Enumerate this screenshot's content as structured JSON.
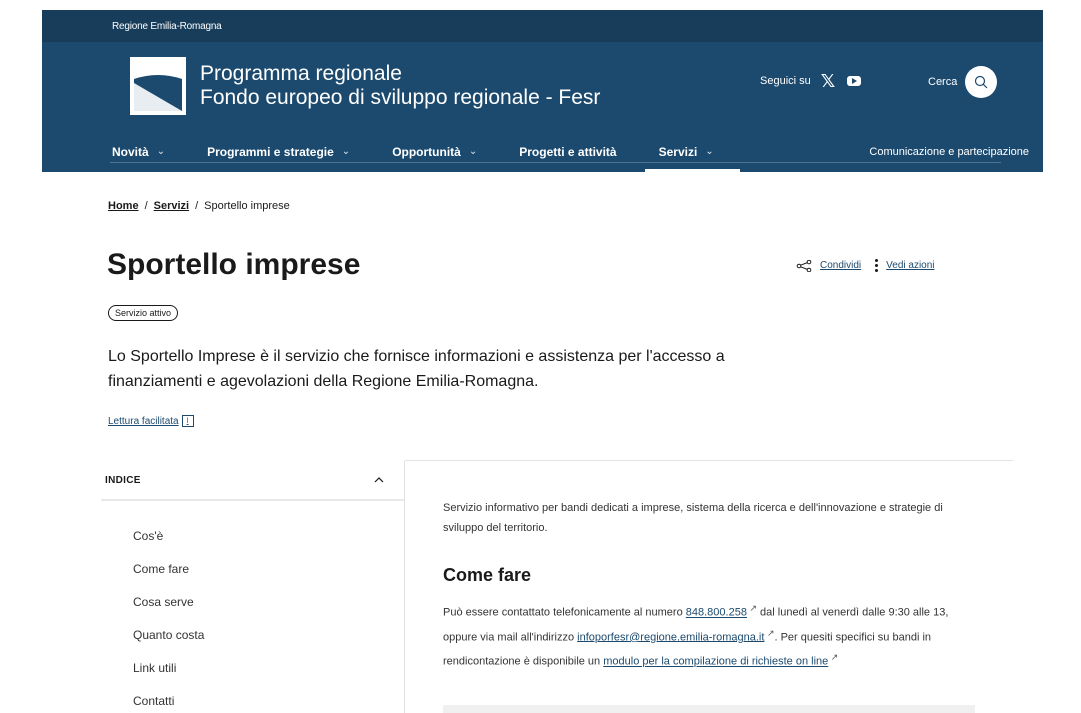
{
  "header": {
    "region_label": "Regione Emilia-Romagna",
    "title_line1": "Programma regionale",
    "title_line2": "Fondo europeo di sviluppo regionale - Fesr",
    "follow_label": "Seguici su",
    "search_label": "Cerca"
  },
  "nav": {
    "items": [
      {
        "label": "Novità"
      },
      {
        "label": "Programmi e strategie"
      },
      {
        "label": "Opportunità"
      },
      {
        "label": "Progetti e attività"
      },
      {
        "label": "Servizi"
      }
    ],
    "right_label": "Comunicazione e partecipazione",
    "chevron": "⌄"
  },
  "breadcrumb": {
    "home": "Home",
    "sep": "/",
    "servizi": "Servizi",
    "current": "Sportello imprese"
  },
  "page": {
    "title": "Sportello imprese",
    "share_label": "Condividi",
    "actions_label": "Vedi azioni",
    "status_badge": "Servizio attivo",
    "lead": "Lo Sportello Imprese è il servizio che fornisce informazioni e assistenza per l'accesso a finanziamenti e agevolazioni della Regione Emilia-Romagna.",
    "easy_read": "Lettura facilitata"
  },
  "index": {
    "heading": "INDICE",
    "items": [
      "Cos'è",
      "Come fare",
      "Cosa serve",
      "Quanto costa",
      "Link utili",
      "Contatti"
    ]
  },
  "content": {
    "intro": "Servizio informativo per bandi dedicati a imprese, sistema della ricerca e dell'innovazione e strategie di sviluppo del territorio.",
    "section_title": "Come fare",
    "p1_a": "Può essere contattato telefonicamente al numero ",
    "phone": "848.800.258",
    "p1_b": " dal lunedì al venerdì dalle 9:30 alle 13, oppure via mail all'indirizzo ",
    "email": "infoporfesr@regione.emilia-romagna.it",
    "p1_c": ". Per quesiti specifici su bandi in rendicontazione è disponibile un ",
    "form_link": "modulo per la compilazione di richieste on line"
  },
  "colors": {
    "header_bg": "#1c4a6e",
    "topbar_bg": "#173d5b",
    "link": "#1c4a6e"
  }
}
